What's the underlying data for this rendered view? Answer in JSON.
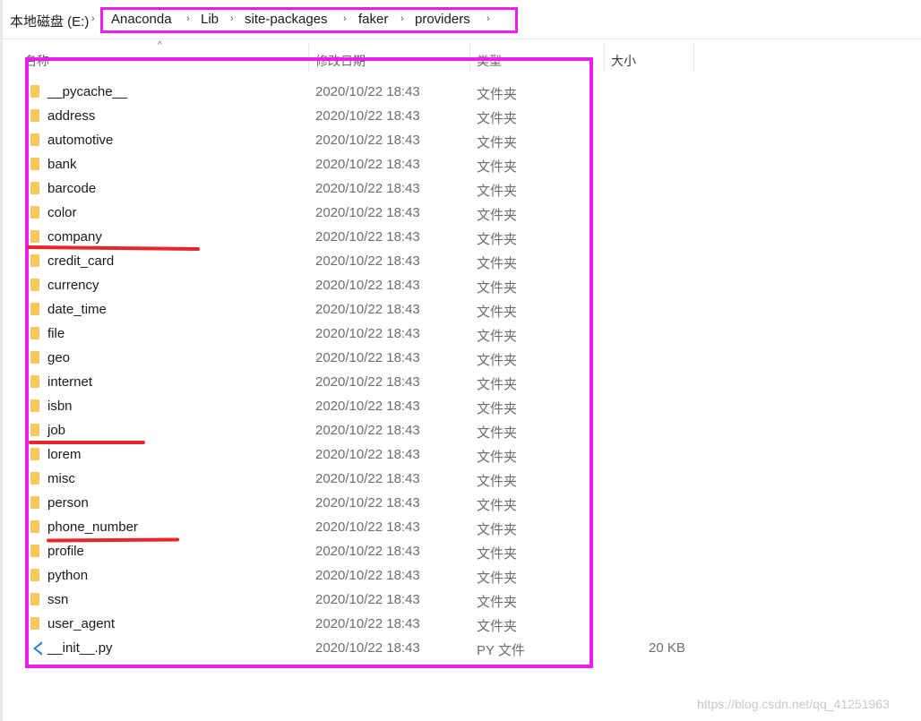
{
  "breadcrumb": {
    "drive": "本地磁盘 (E:)",
    "items": [
      "Anaconda",
      "Lib",
      "site-packages",
      "faker",
      "providers"
    ]
  },
  "columns": {
    "name": "名称",
    "date": "修改日期",
    "type": "类型",
    "size": "大小"
  },
  "files": [
    {
      "name": "__pycache__",
      "date": "2020/10/22 18:43",
      "type": "文件夹",
      "size": "",
      "icon": "folder-icon"
    },
    {
      "name": "address",
      "date": "2020/10/22 18:43",
      "type": "文件夹",
      "size": "",
      "icon": "folder-icon"
    },
    {
      "name": "automotive",
      "date": "2020/10/22 18:43",
      "type": "文件夹",
      "size": "",
      "icon": "folder-icon"
    },
    {
      "name": "bank",
      "date": "2020/10/22 18:43",
      "type": "文件夹",
      "size": "",
      "icon": "folder-icon"
    },
    {
      "name": "barcode",
      "date": "2020/10/22 18:43",
      "type": "文件夹",
      "size": "",
      "icon": "folder-icon"
    },
    {
      "name": "color",
      "date": "2020/10/22 18:43",
      "type": "文件夹",
      "size": "",
      "icon": "folder-icon"
    },
    {
      "name": "company",
      "date": "2020/10/22 18:43",
      "type": "文件夹",
      "size": "",
      "icon": "folder-icon"
    },
    {
      "name": "credit_card",
      "date": "2020/10/22 18:43",
      "type": "文件夹",
      "size": "",
      "icon": "folder-icon"
    },
    {
      "name": "currency",
      "date": "2020/10/22 18:43",
      "type": "文件夹",
      "size": "",
      "icon": "folder-icon"
    },
    {
      "name": "date_time",
      "date": "2020/10/22 18:43",
      "type": "文件夹",
      "size": "",
      "icon": "folder-icon"
    },
    {
      "name": "file",
      "date": "2020/10/22 18:43",
      "type": "文件夹",
      "size": "",
      "icon": "folder-icon"
    },
    {
      "name": "geo",
      "date": "2020/10/22 18:43",
      "type": "文件夹",
      "size": "",
      "icon": "folder-icon"
    },
    {
      "name": "internet",
      "date": "2020/10/22 18:43",
      "type": "文件夹",
      "size": "",
      "icon": "folder-icon"
    },
    {
      "name": "isbn",
      "date": "2020/10/22 18:43",
      "type": "文件夹",
      "size": "",
      "icon": "folder-icon"
    },
    {
      "name": "job",
      "date": "2020/10/22 18:43",
      "type": "文件夹",
      "size": "",
      "icon": "folder-icon"
    },
    {
      "name": "lorem",
      "date": "2020/10/22 18:43",
      "type": "文件夹",
      "size": "",
      "icon": "folder-icon"
    },
    {
      "name": "misc",
      "date": "2020/10/22 18:43",
      "type": "文件夹",
      "size": "",
      "icon": "folder-icon"
    },
    {
      "name": "person",
      "date": "2020/10/22 18:43",
      "type": "文件夹",
      "size": "",
      "icon": "folder-icon"
    },
    {
      "name": "phone_number",
      "date": "2020/10/22 18:43",
      "type": "文件夹",
      "size": "",
      "icon": "folder-icon"
    },
    {
      "name": "profile",
      "date": "2020/10/22 18:43",
      "type": "文件夹",
      "size": "",
      "icon": "folder-icon"
    },
    {
      "name": "python",
      "date": "2020/10/22 18:43",
      "type": "文件夹",
      "size": "",
      "icon": "folder-icon"
    },
    {
      "name": "ssn",
      "date": "2020/10/22 18:43",
      "type": "文件夹",
      "size": "",
      "icon": "folder-icon"
    },
    {
      "name": "user_agent",
      "date": "2020/10/22 18:43",
      "type": "文件夹",
      "size": "",
      "icon": "folder-icon"
    },
    {
      "name": "__init__.py",
      "date": "2020/10/22 18:43",
      "type": "PY 文件",
      "size": "20 KB",
      "icon": "python-file-icon"
    }
  ],
  "annotations": {
    "highlight_color": "#ee1cee",
    "underline_color": "#e8252a",
    "underlined_items": [
      "company",
      "job",
      "phone_number"
    ]
  },
  "watermark": "https://blog.csdn.net/qq_41251963"
}
